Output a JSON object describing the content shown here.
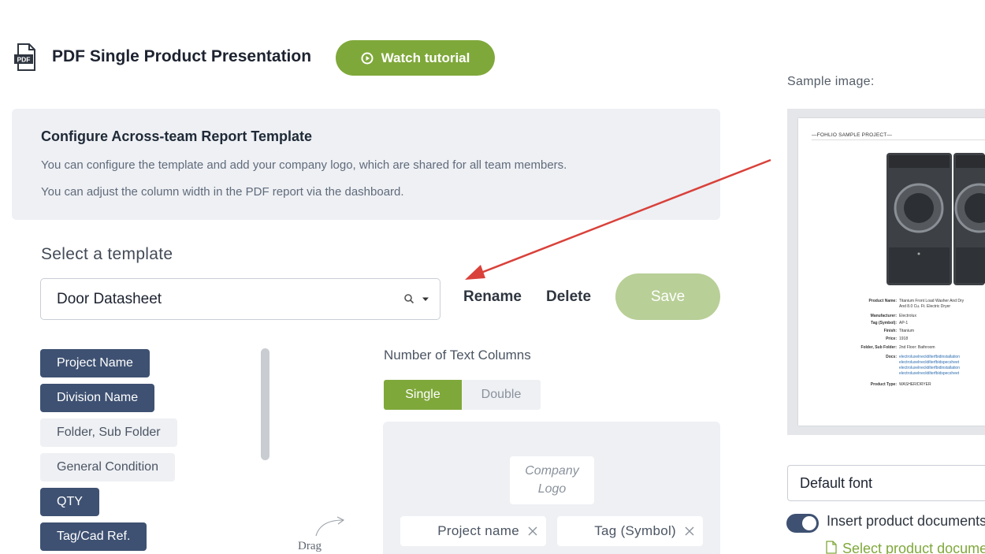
{
  "header": {
    "title": "PDF Single Product Presentation",
    "watch_tutorial": "Watch tutorial",
    "pdf_icon_text": "PDF"
  },
  "info": {
    "title": "Configure Across-team Report Template",
    "line1": "You can configure the template and add your company logo, which are shared for all team members.",
    "line2": "You can adjust the column width in the PDF report via the dashboard."
  },
  "template": {
    "label": "Select a template",
    "selected": "Door Datasheet",
    "rename": "Rename",
    "delete": "Delete",
    "save": "Save"
  },
  "fields": [
    {
      "label": "Project Name",
      "active": true
    },
    {
      "label": "Division Name",
      "active": true
    },
    {
      "label": "Folder, Sub Folder",
      "active": false
    },
    {
      "label": "General Condition",
      "active": false
    },
    {
      "label": "QTY",
      "active": true
    },
    {
      "label": "Tag/Cad Ref.",
      "active": true
    }
  ],
  "drag_hint": "Drag",
  "columns": {
    "label": "Number of Text Columns",
    "options": [
      "Single",
      "Double"
    ],
    "selected": "Single"
  },
  "layout": {
    "company_logo_line1": "Company",
    "company_logo_line2": "Logo",
    "slots": [
      "Project name",
      "Tag (Symbol)"
    ]
  },
  "sample": {
    "label": "Sample image:",
    "doc_title": "—FOHLIO SAMPLE PROJECT—",
    "specs": [
      {
        "k": "Product Name:",
        "v": "Titanium Front Load Washer And Dry"
      },
      {
        "k": "",
        "v": "And 8.0 Cu. Ft. Electric Dryer"
      },
      {
        "k": "Manufacturer:",
        "v": "Electrolux"
      },
      {
        "k": "Tag (Symbol):",
        "v": "AP-1"
      },
      {
        "k": "Finish:",
        "v": "Titanium"
      },
      {
        "k": "Price:",
        "v": "1918"
      },
      {
        "k": "Folder, Sub Folder:",
        "v": "2nd Floor: Bathroom"
      },
      {
        "k": "Docs:",
        "v": "electroluxelnecktilterfbidinstallation"
      },
      {
        "k": "",
        "v": "electroluxelnecktilterfbidspecsheet"
      },
      {
        "k": "",
        "v": "electroluxelnecktilterfbidinstallation"
      },
      {
        "k": "",
        "v": "electroluxelnecktilterfbidspecsheet"
      },
      {
        "k": "Product Type:",
        "v": "WASHER/DRYER"
      }
    ]
  },
  "options": {
    "font": "Default font",
    "insert_docs": "Insert product documents",
    "insert_docs_on": true,
    "select_docs": "Select product documents"
  },
  "colors": {
    "accent_green": "#7fa83a",
    "chip_dark": "#3e5172",
    "annotation_red": "#d9413a"
  }
}
